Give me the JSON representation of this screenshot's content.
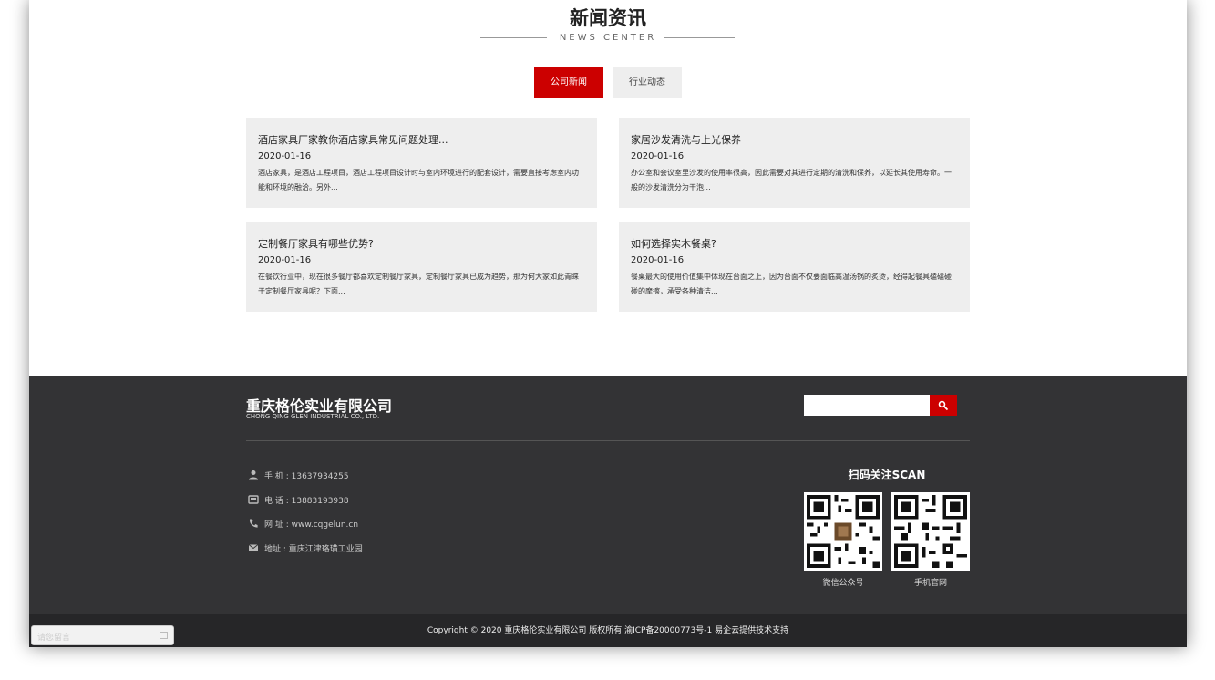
{
  "news": {
    "title": "新闻资讯",
    "subtitle": "NEWS CENTER",
    "tabs": [
      {
        "label": "公司新闻",
        "active": true
      },
      {
        "label": "行业动态",
        "active": false
      }
    ],
    "articles": [
      {
        "title": "酒店家具厂家教你酒店家具常见问题处理...",
        "date": "2020-01-16",
        "desc": "酒店家具，是酒店工程项目，酒店工程项目设计时与室内环境进行的配套设计，需要直接考虑室内功能和环境的融洽。另外..."
      },
      {
        "title": "家居沙发清洗与上光保养",
        "date": "2020-01-16",
        "desc": "办公室和会议室里沙发的使用率很高，因此需要对其进行定期的清洗和保养，以延长其使用寿命。一般的沙发清洗分为干泡..."
      },
      {
        "title": "定制餐厅家具有哪些优势?",
        "date": "2020-01-16",
        "desc": "在餐饮行业中，现在很多餐厅都喜欢定制餐厅家具，定制餐厅家具已成为趋势，那为何大家如此青睐于定制餐厅家具呢？下面..."
      },
      {
        "title": "如何选择实木餐桌?",
        "date": "2020-01-16",
        "desc": "餐桌最大的使用价值集中体现在台面之上，因为台面不仅要面临高温汤锅的炙烫，经得起餐具磕磕碰碰的摩擦，承受各种清洁..."
      }
    ]
  },
  "footer": {
    "company_name": "重庆格伦实业有限公司",
    "company_en": "CHONG QING GLEN INDUSTRIAL CO., LTD.",
    "search_placeholder": "",
    "contacts": [
      {
        "icon": "person-icon",
        "text": "手 机 : 13637934255"
      },
      {
        "icon": "phone-box-icon",
        "text": "电 话 : 13883193938"
      },
      {
        "icon": "telephone-icon",
        "text": "网 址 : www.cqgelun.cn"
      },
      {
        "icon": "mail-icon",
        "text": "地址 : 重庆江津珞璜工业园"
      }
    ],
    "scan_title": "扫码关注SCAN",
    "qr_codes": [
      {
        "label": "微信公众号"
      },
      {
        "label": "手机官网"
      }
    ],
    "copyright": "Copyright © 2020 重庆格伦实业有限公司 版权所有 渝ICP备20000773号-1 易企云提供技术支持"
  },
  "chat": {
    "label": "请您留言"
  },
  "colors": {
    "accent": "#cc0000",
    "footer_bg": "#333335",
    "card_bg": "#eeeeee"
  }
}
